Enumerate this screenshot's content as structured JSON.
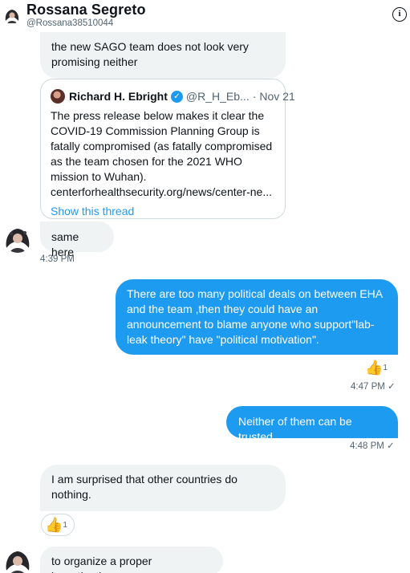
{
  "header": {
    "name": "Rossana Segreto",
    "handle": "@Rossana38510044",
    "info_glyph": "i"
  },
  "messages": {
    "m1": "the new SAGO team does not look very promising neither",
    "quote": {
      "name": "Richard H. Ebright",
      "handle": "@R_H_Eb...",
      "date": "Nov 21",
      "text": "The press release below makes it clear the COVID-19 Commission Planning Group is fatally compromised (as fatally compromised as the team chosen for the 2021 WHO mission to Wuhan). centerforhealthsecurity.org/news/center-ne...",
      "link": "Show this thread"
    },
    "m2": "same here",
    "t2": "4:39 PM",
    "m3": "There are too many political deals on between EHA and the team ,then they could have an announcement to blame anyone who support\"lab-leak theory\" have \"political motivation\".",
    "r3": "1",
    "t3": "4:47 PM ✓",
    "m4": "Neither of them can be trusted",
    "t4": "4:48 PM ✓",
    "m5": "I am surprised that other countries do nothing.",
    "r5": "1",
    "m6": "to organize a proper investigation"
  },
  "icons": {
    "verified": "checkmark-badge",
    "reaction": "thumbs-up",
    "info": "info-circle"
  },
  "colors": {
    "accent": "#1d9bf0",
    "incoming_bubble": "#eff3f4",
    "muted_text": "#536471"
  }
}
